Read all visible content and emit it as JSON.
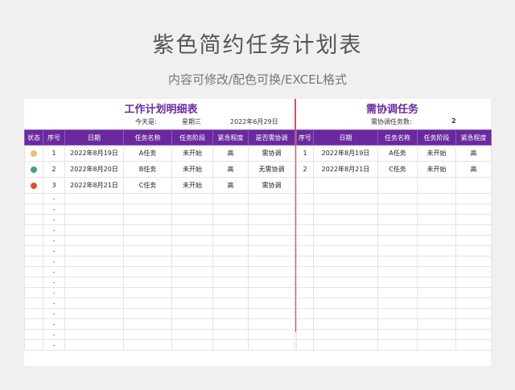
{
  "header": {
    "title": "紫色简约任务计划表",
    "subtitle": "内容可修改/配色可换/EXCEL格式"
  },
  "left": {
    "title": "工作计划明细表",
    "today_label": "今天是:",
    "weekday": "星期三",
    "date": "2022年6月29日",
    "columns": [
      "状态",
      "序号",
      "日期",
      "任务名称",
      "任务阶段",
      "紧急程度",
      "是否需协调"
    ],
    "rows": [
      {
        "status_color": "#e8c36a",
        "no": "1",
        "date": "2022年8月19日",
        "name": "A任务",
        "stage": "未开始",
        "urgency": "高",
        "coord": "需协调"
      },
      {
        "status_color": "#3aa38a",
        "no": "2",
        "date": "2022年8月20日",
        "name": "B任务",
        "stage": "未开始",
        "urgency": "高",
        "coord": "无需协调"
      },
      {
        "status_color": "#d9532b",
        "no": "3",
        "date": "2022年8月21日",
        "name": "C任务",
        "stage": "未开始",
        "urgency": "高",
        "coord": "需协调"
      }
    ],
    "empty_no": "-"
  },
  "right": {
    "title": "需协调任务",
    "count_label": "需协调任务数:",
    "count": "2",
    "columns": [
      "序号",
      "日期",
      "任务名称",
      "任务阶段",
      "紧急程度"
    ],
    "rows": [
      {
        "no": "1",
        "date": "2022年8月19日",
        "name": "A任务",
        "stage": "未开始",
        "urgency": "高"
      },
      {
        "no": "2",
        "date": "2022年8月21日",
        "name": "C任务",
        "stage": "未开始",
        "urgency": "高"
      }
    ]
  }
}
